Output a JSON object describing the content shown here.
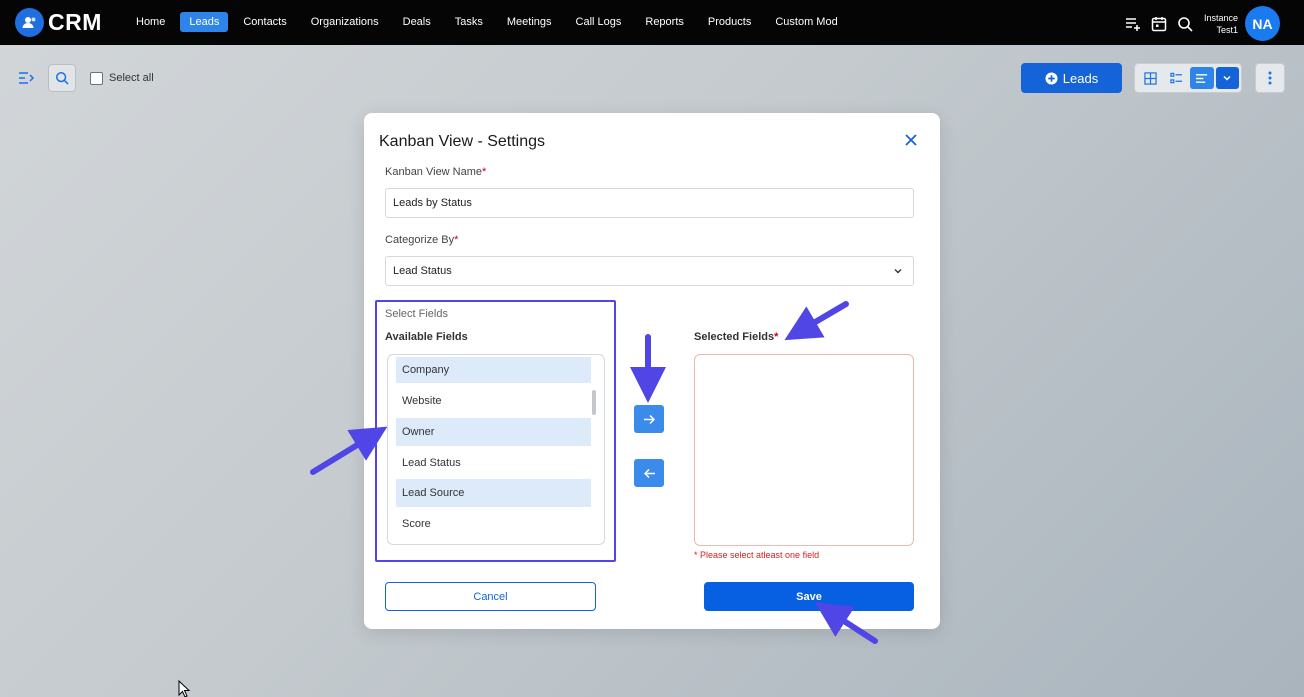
{
  "app": {
    "logo_text": "CRM"
  },
  "nav": {
    "items": [
      "Home",
      "Leads",
      "Contacts",
      "Organizations",
      "Deals",
      "Tasks",
      "Meetings",
      "Call Logs",
      "Reports",
      "Products",
      "Custom Mod"
    ],
    "active": "Leads"
  },
  "user": {
    "name_line1": "Instance",
    "name_line2": "Test1",
    "initials": "NA"
  },
  "toolbar": {
    "select_all_label": "Select all",
    "leads_button_label": "Leads"
  },
  "modal": {
    "title": "Kanban View - Settings",
    "view_name_label": "Kanban View Name",
    "view_name_value": "Leads by Status",
    "categorize_label": "Categorize By",
    "categorize_value": "Lead Status",
    "select_fields_label": "Select Fields",
    "available_fields_label": "Available Fields",
    "available_fields": [
      "Company",
      "Website",
      "Owner",
      "Lead Status",
      "Lead Source",
      "Score"
    ],
    "selected_fields_label": "Selected Fields",
    "required_marker": "*",
    "error_text": "* Please select atleast one field",
    "cancel_label": "Cancel",
    "save_label": "Save"
  },
  "colors": {
    "accent": "#1463d8",
    "nav_active": "#2e84e8",
    "annotation": "#5345e6",
    "error": "#d32020"
  }
}
